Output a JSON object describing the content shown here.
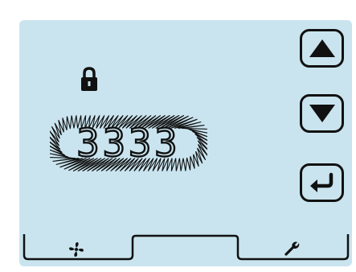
{
  "display": {
    "code": "3333",
    "locked": true
  },
  "buttons": {
    "up": "arrow-up-icon",
    "down": "arrow-down-icon",
    "enter": "enter-return-icon"
  },
  "tabs": [
    {
      "icon": "fan-icon"
    },
    {
      "icon": ""
    },
    {
      "icon": "wrench-icon"
    }
  ],
  "colors": {
    "screen_bg": "#c9e4ef",
    "ink": "#111111"
  }
}
